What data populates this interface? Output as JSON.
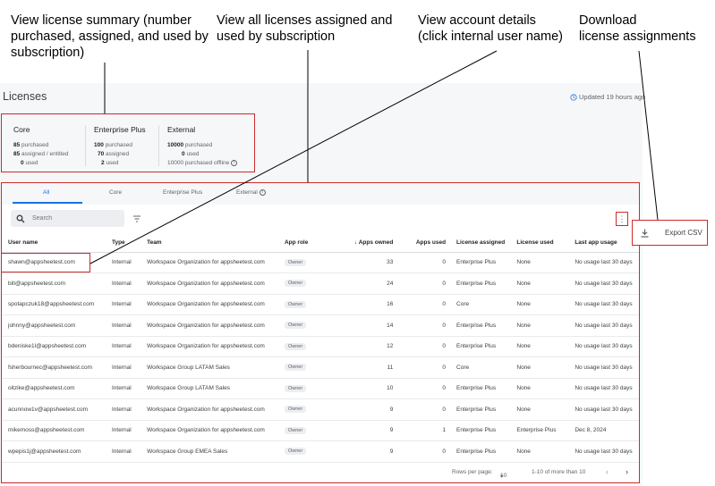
{
  "callouts": {
    "summary": "View license summary (number purchased, assigned, and used by subscription)",
    "by_subscription": "View all licenses assigned and used by subscription",
    "account": "View account details\n(click internal user name)",
    "download": "Download\nlicense assignments"
  },
  "header": {
    "title": "Licenses",
    "updated": "Updated 19 hours ago"
  },
  "summary": [
    {
      "name": "Core",
      "lines": [
        [
          "85",
          "purchased"
        ],
        [
          "85",
          "assigned / entitled"
        ],
        [
          "0",
          "used"
        ]
      ]
    },
    {
      "name": "Enterprise Plus",
      "lines": [
        [
          "100",
          "purchased"
        ],
        [
          "70",
          "assigned"
        ],
        [
          "2",
          "used"
        ]
      ]
    },
    {
      "name": "External",
      "lines": [
        [
          "10000",
          "purchased"
        ],
        [
          "0",
          "used"
        ],
        [
          "10000",
          "purchased offline"
        ]
      ]
    }
  ],
  "tabs": [
    "All",
    "Core",
    "Enterprise Plus",
    "External"
  ],
  "search": {
    "placeholder": "Search"
  },
  "columns": [
    "User name",
    "Type",
    "Team",
    "App role",
    "Apps owned",
    "Apps used",
    "License assigned",
    "License used",
    "Last app usage"
  ],
  "rows": [
    [
      "shawn@appsheetest.com",
      "Internal",
      "Workspace Organization for appsheetest.com",
      "Owner",
      "33",
      "0",
      "Enterprise Plus",
      "None",
      "No usage last 30 days"
    ],
    [
      "bill@appsheetest.com",
      "Internal",
      "Workspace Organization for appsheetest.com",
      "Owner",
      "24",
      "0",
      "Enterprise Plus",
      "None",
      "No usage last 30 days"
    ],
    [
      "spotapczuk18@appsheetest.com",
      "Internal",
      "Workspace Organization for appsheetest.com",
      "Owner",
      "16",
      "0",
      "Core",
      "None",
      "No usage last 30 days"
    ],
    [
      "johnny@appsheetest.com",
      "Internal",
      "Workspace Organization for appsheetest.com",
      "Owner",
      "14",
      "0",
      "Enterprise Plus",
      "None",
      "No usage last 30 days"
    ],
    [
      "bdeniske1l@appsheetest.com",
      "Internal",
      "Workspace Organization for appsheetest.com",
      "Owner",
      "12",
      "0",
      "Enterprise Plus",
      "None",
      "No usage last 30 days"
    ],
    [
      "fsherbournec@appsheetest.com",
      "Internal",
      "Workspace Group LATAM Sales",
      "Owner",
      "11",
      "0",
      "Core",
      "None",
      "No usage last 30 days"
    ],
    [
      "oitzike@appsheetest.com",
      "Internal",
      "Workspace Group LATAM Sales",
      "Owner",
      "10",
      "0",
      "Enterprise Plus",
      "None",
      "No usage last 30 days"
    ],
    [
      "acunnow1v@appsheetest.com",
      "Internal",
      "Workspace Organization for appsheetest.com",
      "Owner",
      "9",
      "0",
      "Enterprise Plus",
      "None",
      "No usage last 30 days"
    ],
    [
      "mikemoss@appsheetest.com",
      "Internal",
      "Workspace Organization for appsheetest.com",
      "Owner",
      "9",
      "1",
      "Enterprise Plus",
      "Enterprise Plus",
      "Dec 8, 2024"
    ],
    [
      "wpepis1j@appsheetest.com",
      "Internal",
      "Workspace Group EMEA Sales",
      "Owner",
      "9",
      "0",
      "Enterprise Plus",
      "None",
      "No usage last 30 days"
    ]
  ],
  "pagination": {
    "rows_label": "Rows per page:",
    "rows_value": "10",
    "range": "1-10 of more than 10"
  },
  "export": {
    "label": "Export CSV"
  },
  "icons": {
    "search": "search-icon",
    "filter": "filter-icon",
    "more": "more-vert-icon",
    "download": "download-icon",
    "clock": "clock-icon",
    "info": "info-icon",
    "sort": "arrow-down-icon"
  },
  "colors": {
    "accent": "#1a73e8",
    "callout_border": "#cc2b2b"
  }
}
